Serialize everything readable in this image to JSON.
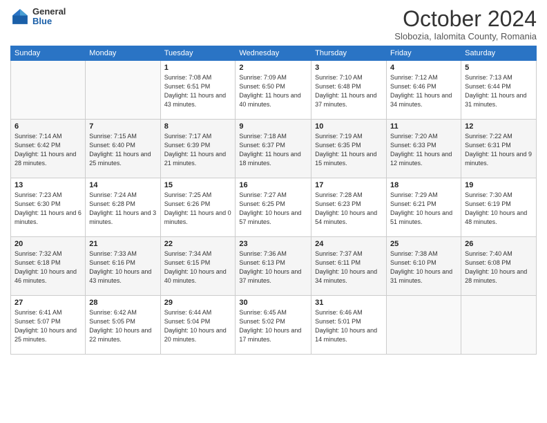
{
  "header": {
    "logo": {
      "general": "General",
      "blue": "Blue"
    },
    "title": "October 2024",
    "subtitle": "Slobozia, Ialomita County, Romania"
  },
  "weekdays": [
    "Sunday",
    "Monday",
    "Tuesday",
    "Wednesday",
    "Thursday",
    "Friday",
    "Saturday"
  ],
  "weeks": [
    [
      {
        "day": "",
        "sunrise": "",
        "sunset": "",
        "daylight": ""
      },
      {
        "day": "",
        "sunrise": "",
        "sunset": "",
        "daylight": ""
      },
      {
        "day": "1",
        "sunrise": "Sunrise: 7:08 AM",
        "sunset": "Sunset: 6:51 PM",
        "daylight": "Daylight: 11 hours and 43 minutes."
      },
      {
        "day": "2",
        "sunrise": "Sunrise: 7:09 AM",
        "sunset": "Sunset: 6:50 PM",
        "daylight": "Daylight: 11 hours and 40 minutes."
      },
      {
        "day": "3",
        "sunrise": "Sunrise: 7:10 AM",
        "sunset": "Sunset: 6:48 PM",
        "daylight": "Daylight: 11 hours and 37 minutes."
      },
      {
        "day": "4",
        "sunrise": "Sunrise: 7:12 AM",
        "sunset": "Sunset: 6:46 PM",
        "daylight": "Daylight: 11 hours and 34 minutes."
      },
      {
        "day": "5",
        "sunrise": "Sunrise: 7:13 AM",
        "sunset": "Sunset: 6:44 PM",
        "daylight": "Daylight: 11 hours and 31 minutes."
      }
    ],
    [
      {
        "day": "6",
        "sunrise": "Sunrise: 7:14 AM",
        "sunset": "Sunset: 6:42 PM",
        "daylight": "Daylight: 11 hours and 28 minutes."
      },
      {
        "day": "7",
        "sunrise": "Sunrise: 7:15 AM",
        "sunset": "Sunset: 6:40 PM",
        "daylight": "Daylight: 11 hours and 25 minutes."
      },
      {
        "day": "8",
        "sunrise": "Sunrise: 7:17 AM",
        "sunset": "Sunset: 6:39 PM",
        "daylight": "Daylight: 11 hours and 21 minutes."
      },
      {
        "day": "9",
        "sunrise": "Sunrise: 7:18 AM",
        "sunset": "Sunset: 6:37 PM",
        "daylight": "Daylight: 11 hours and 18 minutes."
      },
      {
        "day": "10",
        "sunrise": "Sunrise: 7:19 AM",
        "sunset": "Sunset: 6:35 PM",
        "daylight": "Daylight: 11 hours and 15 minutes."
      },
      {
        "day": "11",
        "sunrise": "Sunrise: 7:20 AM",
        "sunset": "Sunset: 6:33 PM",
        "daylight": "Daylight: 11 hours and 12 minutes."
      },
      {
        "day": "12",
        "sunrise": "Sunrise: 7:22 AM",
        "sunset": "Sunset: 6:31 PM",
        "daylight": "Daylight: 11 hours and 9 minutes."
      }
    ],
    [
      {
        "day": "13",
        "sunrise": "Sunrise: 7:23 AM",
        "sunset": "Sunset: 6:30 PM",
        "daylight": "Daylight: 11 hours and 6 minutes."
      },
      {
        "day": "14",
        "sunrise": "Sunrise: 7:24 AM",
        "sunset": "Sunset: 6:28 PM",
        "daylight": "Daylight: 11 hours and 3 minutes."
      },
      {
        "day": "15",
        "sunrise": "Sunrise: 7:25 AM",
        "sunset": "Sunset: 6:26 PM",
        "daylight": "Daylight: 11 hours and 0 minutes."
      },
      {
        "day": "16",
        "sunrise": "Sunrise: 7:27 AM",
        "sunset": "Sunset: 6:25 PM",
        "daylight": "Daylight: 10 hours and 57 minutes."
      },
      {
        "day": "17",
        "sunrise": "Sunrise: 7:28 AM",
        "sunset": "Sunset: 6:23 PM",
        "daylight": "Daylight: 10 hours and 54 minutes."
      },
      {
        "day": "18",
        "sunrise": "Sunrise: 7:29 AM",
        "sunset": "Sunset: 6:21 PM",
        "daylight": "Daylight: 10 hours and 51 minutes."
      },
      {
        "day": "19",
        "sunrise": "Sunrise: 7:30 AM",
        "sunset": "Sunset: 6:19 PM",
        "daylight": "Daylight: 10 hours and 48 minutes."
      }
    ],
    [
      {
        "day": "20",
        "sunrise": "Sunrise: 7:32 AM",
        "sunset": "Sunset: 6:18 PM",
        "daylight": "Daylight: 10 hours and 46 minutes."
      },
      {
        "day": "21",
        "sunrise": "Sunrise: 7:33 AM",
        "sunset": "Sunset: 6:16 PM",
        "daylight": "Daylight: 10 hours and 43 minutes."
      },
      {
        "day": "22",
        "sunrise": "Sunrise: 7:34 AM",
        "sunset": "Sunset: 6:15 PM",
        "daylight": "Daylight: 10 hours and 40 minutes."
      },
      {
        "day": "23",
        "sunrise": "Sunrise: 7:36 AM",
        "sunset": "Sunset: 6:13 PM",
        "daylight": "Daylight: 10 hours and 37 minutes."
      },
      {
        "day": "24",
        "sunrise": "Sunrise: 7:37 AM",
        "sunset": "Sunset: 6:11 PM",
        "daylight": "Daylight: 10 hours and 34 minutes."
      },
      {
        "day": "25",
        "sunrise": "Sunrise: 7:38 AM",
        "sunset": "Sunset: 6:10 PM",
        "daylight": "Daylight: 10 hours and 31 minutes."
      },
      {
        "day": "26",
        "sunrise": "Sunrise: 7:40 AM",
        "sunset": "Sunset: 6:08 PM",
        "daylight": "Daylight: 10 hours and 28 minutes."
      }
    ],
    [
      {
        "day": "27",
        "sunrise": "Sunrise: 6:41 AM",
        "sunset": "Sunset: 5:07 PM",
        "daylight": "Daylight: 10 hours and 25 minutes."
      },
      {
        "day": "28",
        "sunrise": "Sunrise: 6:42 AM",
        "sunset": "Sunset: 5:05 PM",
        "daylight": "Daylight: 10 hours and 22 minutes."
      },
      {
        "day": "29",
        "sunrise": "Sunrise: 6:44 AM",
        "sunset": "Sunset: 5:04 PM",
        "daylight": "Daylight: 10 hours and 20 minutes."
      },
      {
        "day": "30",
        "sunrise": "Sunrise: 6:45 AM",
        "sunset": "Sunset: 5:02 PM",
        "daylight": "Daylight: 10 hours and 17 minutes."
      },
      {
        "day": "31",
        "sunrise": "Sunrise: 6:46 AM",
        "sunset": "Sunset: 5:01 PM",
        "daylight": "Daylight: 10 hours and 14 minutes."
      },
      {
        "day": "",
        "sunrise": "",
        "sunset": "",
        "daylight": ""
      },
      {
        "day": "",
        "sunrise": "",
        "sunset": "",
        "daylight": ""
      }
    ]
  ]
}
